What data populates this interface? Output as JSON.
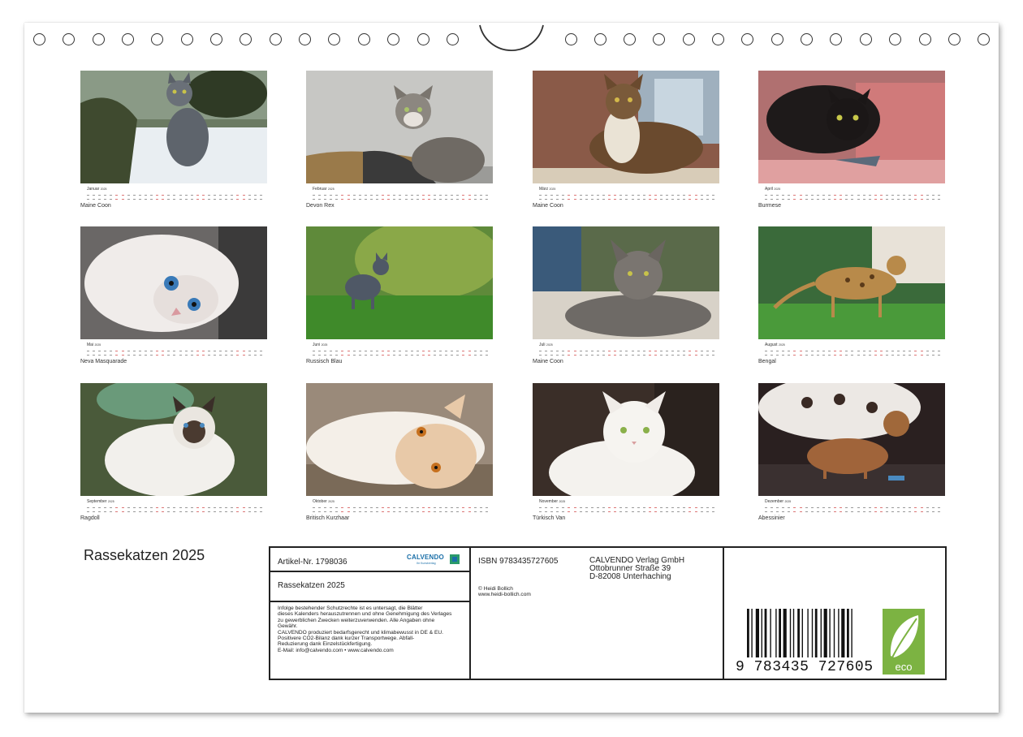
{
  "calendar": {
    "title": "Rassekatzen 2025",
    "months": [
      {
        "name": "Januar",
        "year": "2025",
        "caption": "Maine Coon",
        "image": "maine-coon-in-snow"
      },
      {
        "name": "Februar",
        "year": "2025",
        "caption": "Devon Rex",
        "image": "devon-rex-on-scratcher"
      },
      {
        "name": "März",
        "year": "2025",
        "caption": "Maine Coon",
        "image": "maine-coon-sitting"
      },
      {
        "name": "April",
        "year": "2025",
        "caption": "Burmese",
        "image": "black-burmese-on-chair"
      },
      {
        "name": "Mai",
        "year": "2025",
        "caption": "Neva Masquarade",
        "image": "blue-eyed-kitten"
      },
      {
        "name": "Juni",
        "year": "2025",
        "caption": "Russisch Blau",
        "image": "russian-blue-on-grass"
      },
      {
        "name": "Juli",
        "year": "2025",
        "caption": "Maine Coon",
        "image": "maine-coon-lying"
      },
      {
        "name": "August",
        "year": "2025",
        "caption": "Bengal",
        "image": "bengal-on-lawn"
      },
      {
        "name": "September",
        "year": "2025",
        "caption": "Ragdoll",
        "image": "ragdoll-kitten"
      },
      {
        "name": "Oktober",
        "year": "2025",
        "caption": "Britisch Kurzhaar",
        "image": "cream-shorthair-lying"
      },
      {
        "name": "November",
        "year": "2025",
        "caption": "Türkisch Van",
        "image": "white-turkish-van"
      },
      {
        "name": "Dezember",
        "year": "2025",
        "caption": "Abessinier",
        "image": "abyssinian-kittens"
      }
    ]
  },
  "infobox": {
    "article": "Artikel-Nr. 1798036",
    "logo": {
      "word": "CALVENDO",
      "sub": "Ihr Kunstverlag"
    },
    "title": "Rassekatzen 2025",
    "legal": [
      "Infolge bestehender Schutzrechte ist es untersagt, die Blätter",
      "dieses Kalenders herauszutrennen und ohne Genehmigung des Verlages",
      "zu gewerblichen Zwecken weiterzuverwenden. Alle Angaben ohne",
      "Gewähr.",
      "CALVENDO produziert bedarfsgerecht und klimabewusst in DE & EU.",
      "Positivere CO2-Bilanz dank kurzer Transportwege. Abfall-",
      "Reduzierung dank Einzelstückfertigung.",
      "E-Mail: info@calvendo.com • www.calvendo.com"
    ],
    "isbn": "ISBN 9783435727605",
    "publisher": [
      "CALVENDO Verlag GmbH",
      "Ottobrunner Straße 39",
      "D-82008 Unterhaching"
    ],
    "author": [
      "© Heidi Bollich",
      "www.heidi-bollich.com"
    ],
    "barcode_digits": "9  783435  727605",
    "eco_label": "eco"
  }
}
